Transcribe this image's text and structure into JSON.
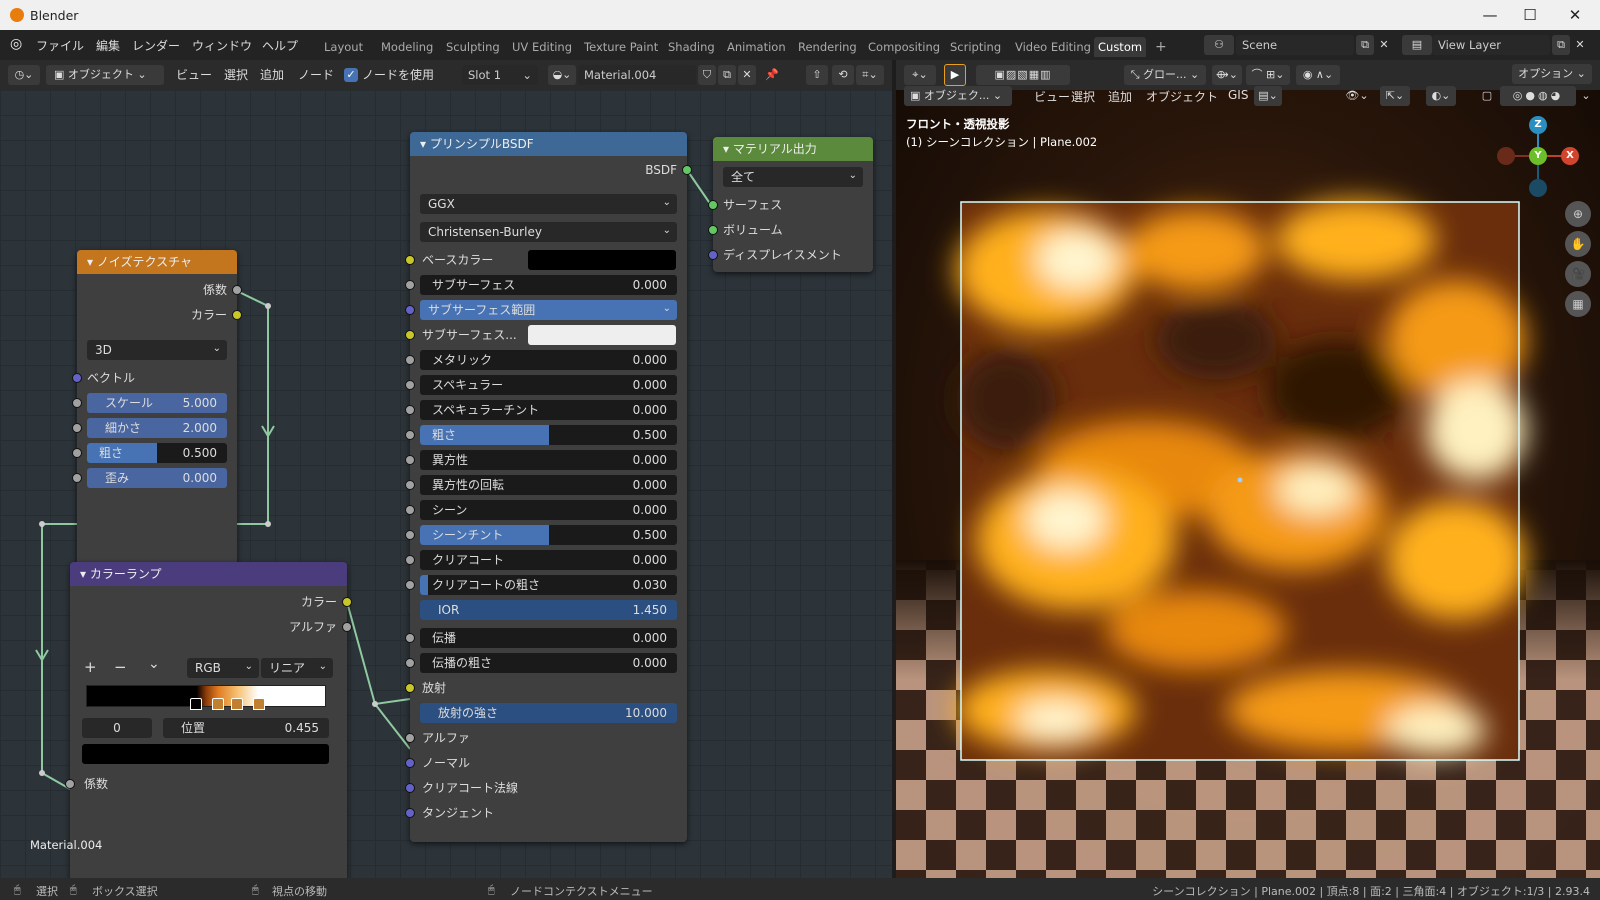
{
  "window": {
    "title": "Blender",
    "minimize": "—",
    "maximize": "☐",
    "close": "✕"
  },
  "menu": {
    "items": [
      "ファイル",
      "編集",
      "レンダー",
      "ウィンドウ",
      "ヘルプ"
    ]
  },
  "workspaces": {
    "tabs": [
      "Layout",
      "Modeling",
      "Sculpting",
      "UV Editing",
      "Texture Paint",
      "Shading",
      "Animation",
      "Rendering",
      "Compositing",
      "Scripting",
      "Video Editing",
      "Custom"
    ],
    "active": "Custom",
    "add": "+"
  },
  "scene": {
    "name": "Scene",
    "view_layer": "View Layer"
  },
  "node_header": {
    "mode": "オブジェクト",
    "items": [
      "ビュー",
      "選択",
      "追加",
      "ノード"
    ],
    "use_nodes_label": "ノードを使用",
    "slot": "Slot 1",
    "material": "Material.004"
  },
  "viewport_header": {
    "orientation": "グロー...",
    "mode": "オブジェク...",
    "items": [
      "ビュー",
      "選択",
      "追加",
      "オブジェクト",
      "GIS"
    ],
    "options": "オプション"
  },
  "viewport": {
    "view_name": "フロント・透視投影",
    "collection_info": "(1) シーンコレクション | Plane.002"
  },
  "noise_node": {
    "title": "ノイズテクスチャ",
    "out_fac": "係数",
    "out_color": "カラー",
    "dimension": "3D",
    "vector": "ベクトル",
    "scale_label": "スケール",
    "scale": "5.000",
    "detail_label": "細かさ",
    "detail": "2.000",
    "rough_label": "粗さ",
    "rough": "0.500",
    "rough_fill": 0.5,
    "distortion_label": "歪み",
    "distortion": "0.000"
  },
  "ramp_node": {
    "title": "カラーランプ",
    "out_color": "カラー",
    "out_alpha": "アルファ",
    "add": "+",
    "remove": "−",
    "menu": "⌄",
    "color_mode": "RGB",
    "interp": "リニア",
    "index": "0",
    "pos_label": "位置",
    "pos": "0.455",
    "in_fac": "係数",
    "stop_positions": [
      0.46,
      0.55,
      0.63,
      0.72
    ]
  },
  "bsdf_node": {
    "title": "プリンシプルBSDF",
    "out": "BSDF",
    "distribution": "GGX",
    "subsurface_method": "Christensen-Burley",
    "base_color": "ベースカラー",
    "subsurface_radius": "サブサーフェス範囲",
    "subsurface_color": "サブサーフェス...",
    "sliders": [
      {
        "label": "サブサーフェス",
        "value": "0.000",
        "fill": 0
      },
      {
        "label": "メタリック",
        "value": "0.000",
        "fill": 0
      },
      {
        "label": "スペキュラー",
        "value": "0.000",
        "fill": 0
      },
      {
        "label": "スペキュラーチント",
        "value": "0.000",
        "fill": 0
      },
      {
        "label": "粗さ",
        "value": "0.500",
        "fill": 0.5
      },
      {
        "label": "異方性",
        "value": "0.000",
        "fill": 0
      },
      {
        "label": "異方性の回転",
        "value": "0.000",
        "fill": 0
      },
      {
        "label": "シーン",
        "value": "0.000",
        "fill": 0
      },
      {
        "label": "シーンチント",
        "value": "0.500",
        "fill": 0.5
      },
      {
        "label": "クリアコート",
        "value": "0.000",
        "fill": 0
      },
      {
        "label": "クリアコートの粗さ",
        "value": "0.030",
        "fill": 0.03
      },
      {
        "label": "IOR",
        "value": "1.450",
        "fill": 1
      },
      {
        "label": "伝播",
        "value": "0.000",
        "fill": 0
      },
      {
        "label": "伝播の粗さ",
        "value": "0.000",
        "fill": 0
      }
    ],
    "emission": "放射",
    "emission_strength_label": "放射の強さ",
    "emission_strength": "10.000",
    "alpha": "アルファ",
    "normal": "ノーマル",
    "clearcoat_normal": "クリアコート法線",
    "tangent": "タンジェント"
  },
  "output_node": {
    "title": "マテリアル出力",
    "target": "全て",
    "surface": "サーフェス",
    "volume": "ボリューム",
    "displacement": "ディスプレイスメント"
  },
  "material_label": "Material.004",
  "status": {
    "select": "選択",
    "box_select": "ボックス選択",
    "pan": "視点の移動",
    "context": "ノードコンテクストメニュー",
    "stats": "シーンコレクション | Plane.002 | 頂点:8 | 面:2 | 三角面:4 | オブジェクト:1/3 | 2.93.4"
  },
  "gizmo": {
    "z": "Z",
    "y": "Y",
    "x": "X"
  }
}
